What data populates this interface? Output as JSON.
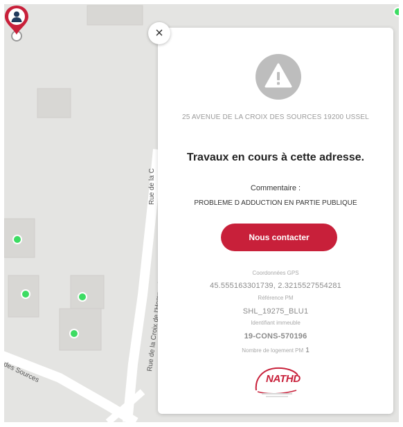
{
  "map": {
    "streets": {
      "street_1": "Rue de la C",
      "street_2": "Rue de la Croix de l'Homme Maure",
      "street_3": "des Sources"
    },
    "marker_color": "#3ddc63",
    "pin_color": "#c8203a"
  },
  "popup": {
    "close_symbol": "×",
    "address": "25 AVENUE DE LA CROIX DES SOURCES 19200 USSEL",
    "headline": "Travaux en cours à cette adresse.",
    "comment_label": "Commentaire :",
    "comment_text": "PROBLEME D ADDUCTION EN PARTIE PUBLIQUE",
    "contact_button": "Nous contacter",
    "gps_label": "Coordonnées GPS",
    "gps_value": "45.555163301739, 2.3215527554281",
    "pm_label": "Référence PM",
    "pm_value": "SHL_19275_BLU1",
    "building_label": "Identifiant immeuble",
    "building_value": "19-CONS-570196",
    "count_label": "Nombre de logement PM",
    "count_value": "1",
    "logo_text": "NATHD",
    "accent_color": "#c8203a",
    "warning_icon": "warning-triangle-icon"
  }
}
